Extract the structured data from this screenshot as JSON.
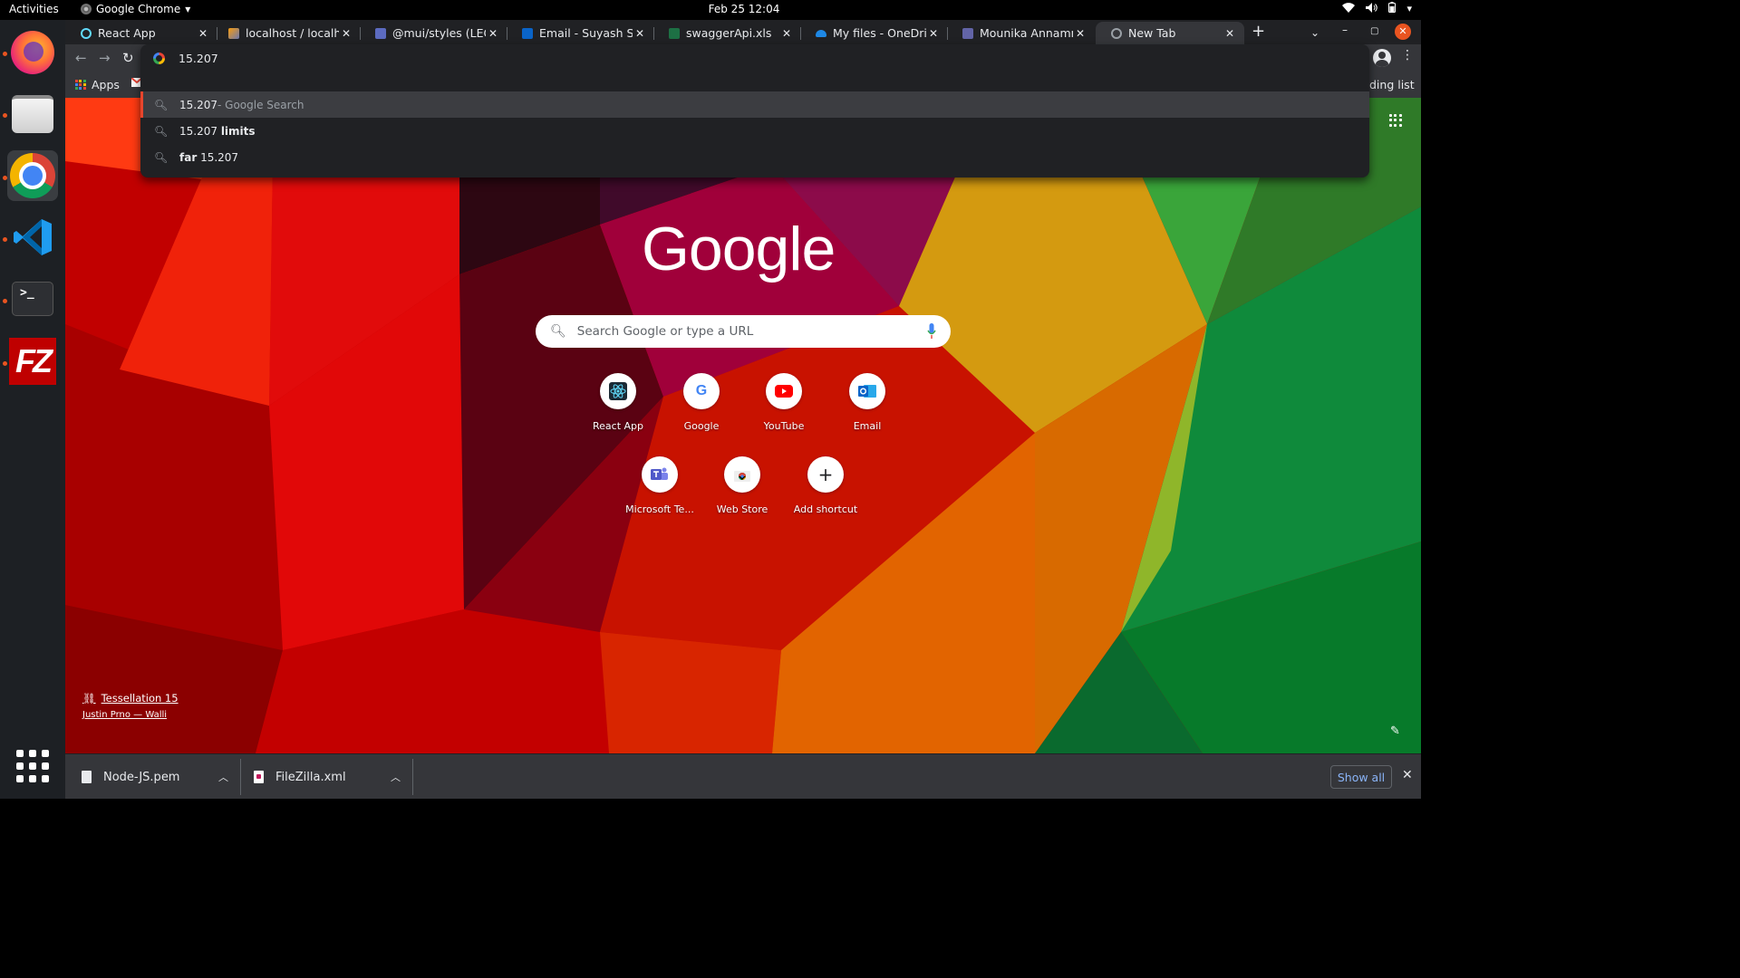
{
  "topbar": {
    "activities": "Activities",
    "app_name": "Google Chrome",
    "clock": "Feb 25  12:04",
    "tray_icons": [
      "wifi-icon",
      "volume-icon",
      "battery-icon",
      "power-menu-icon"
    ]
  },
  "dock": {
    "items": [
      {
        "name": "firefox",
        "icon": "firefox-icon",
        "running": true
      },
      {
        "name": "files",
        "icon": "files-icon",
        "running": true
      },
      {
        "name": "chrome",
        "icon": "chrome-icon",
        "running": true,
        "active": true
      },
      {
        "name": "vscode",
        "icon": "vscode-icon",
        "running": true
      },
      {
        "name": "terminal",
        "icon": "terminal-icon",
        "running": true,
        "text": ">_"
      },
      {
        "name": "filezilla",
        "icon": "filezilla-icon",
        "running": true,
        "text": "FZ"
      }
    ],
    "show_apps_icon": "show-applications-icon"
  },
  "tabs": [
    {
      "title": "React App",
      "icon": "react-icon",
      "color": "#61dafb"
    },
    {
      "title": "localhost / localhost",
      "icon": "phpmyadmin-icon",
      "color": "#f89c0e"
    },
    {
      "title": "@mui/styles (LEGACY",
      "icon": "mui-icon",
      "color": "#5c6bc0"
    },
    {
      "title": "Email - Suyash Shen",
      "icon": "outlook-icon",
      "color": "#0a64c8"
    },
    {
      "title": "swaggerApi.xls",
      "icon": "excel-icon",
      "color": "#1d7044"
    },
    {
      "title": "My files - OneDrive",
      "icon": "onedrive-icon",
      "color": "#1e88e5"
    },
    {
      "title": "Mounika Annamnen",
      "icon": "teams-icon",
      "color": "#6264a7"
    },
    {
      "title": "New Tab",
      "icon": "chrome-icon",
      "color": "#9aa0a6",
      "active": true
    }
  ],
  "omnibox": {
    "value": "15.207",
    "suggestions": [
      {
        "text": "15.207",
        "muted": " - Google Search",
        "bold": "",
        "selected": true
      },
      {
        "text": "15.207 ",
        "muted": "",
        "bold": "limits",
        "selected": false
      },
      {
        "text": " 15.207",
        "muted": "",
        "bold": "far",
        "selected": false,
        "bold_first": true
      }
    ]
  },
  "bookmarks": {
    "apps": "Apps",
    "reading_list": "ding list"
  },
  "ntp": {
    "logo": "Google",
    "search_placeholder": "Search Google or type a URL",
    "shortcuts": [
      {
        "label": "React App",
        "icon": "react-icon"
      },
      {
        "label": "Google",
        "icon": "google-icon"
      },
      {
        "label": "YouTube",
        "icon": "youtube-icon"
      },
      {
        "label": "Email",
        "icon": "outlook-icon"
      },
      {
        "label": "Microsoft Te...",
        "icon": "teams-icon"
      },
      {
        "label": "Web Store",
        "icon": "webstore-icon"
      },
      {
        "label": "Add shortcut",
        "icon": "plus-icon"
      }
    ],
    "attribution_title": "Tessellation 15",
    "attribution_author": "Justin Prno — Walli"
  },
  "downloads": {
    "items": [
      {
        "name": "Node-JS.pem",
        "icon": "file-icon"
      },
      {
        "name": "FileZilla.xml",
        "icon": "xml-file-icon"
      }
    ],
    "show_all": "Show all"
  },
  "colors": {
    "chrome_dark": "#202124",
    "toolbar": "#35363a",
    "link_blue": "#8ab4f8",
    "ubuntu_orange": "#e95420"
  }
}
